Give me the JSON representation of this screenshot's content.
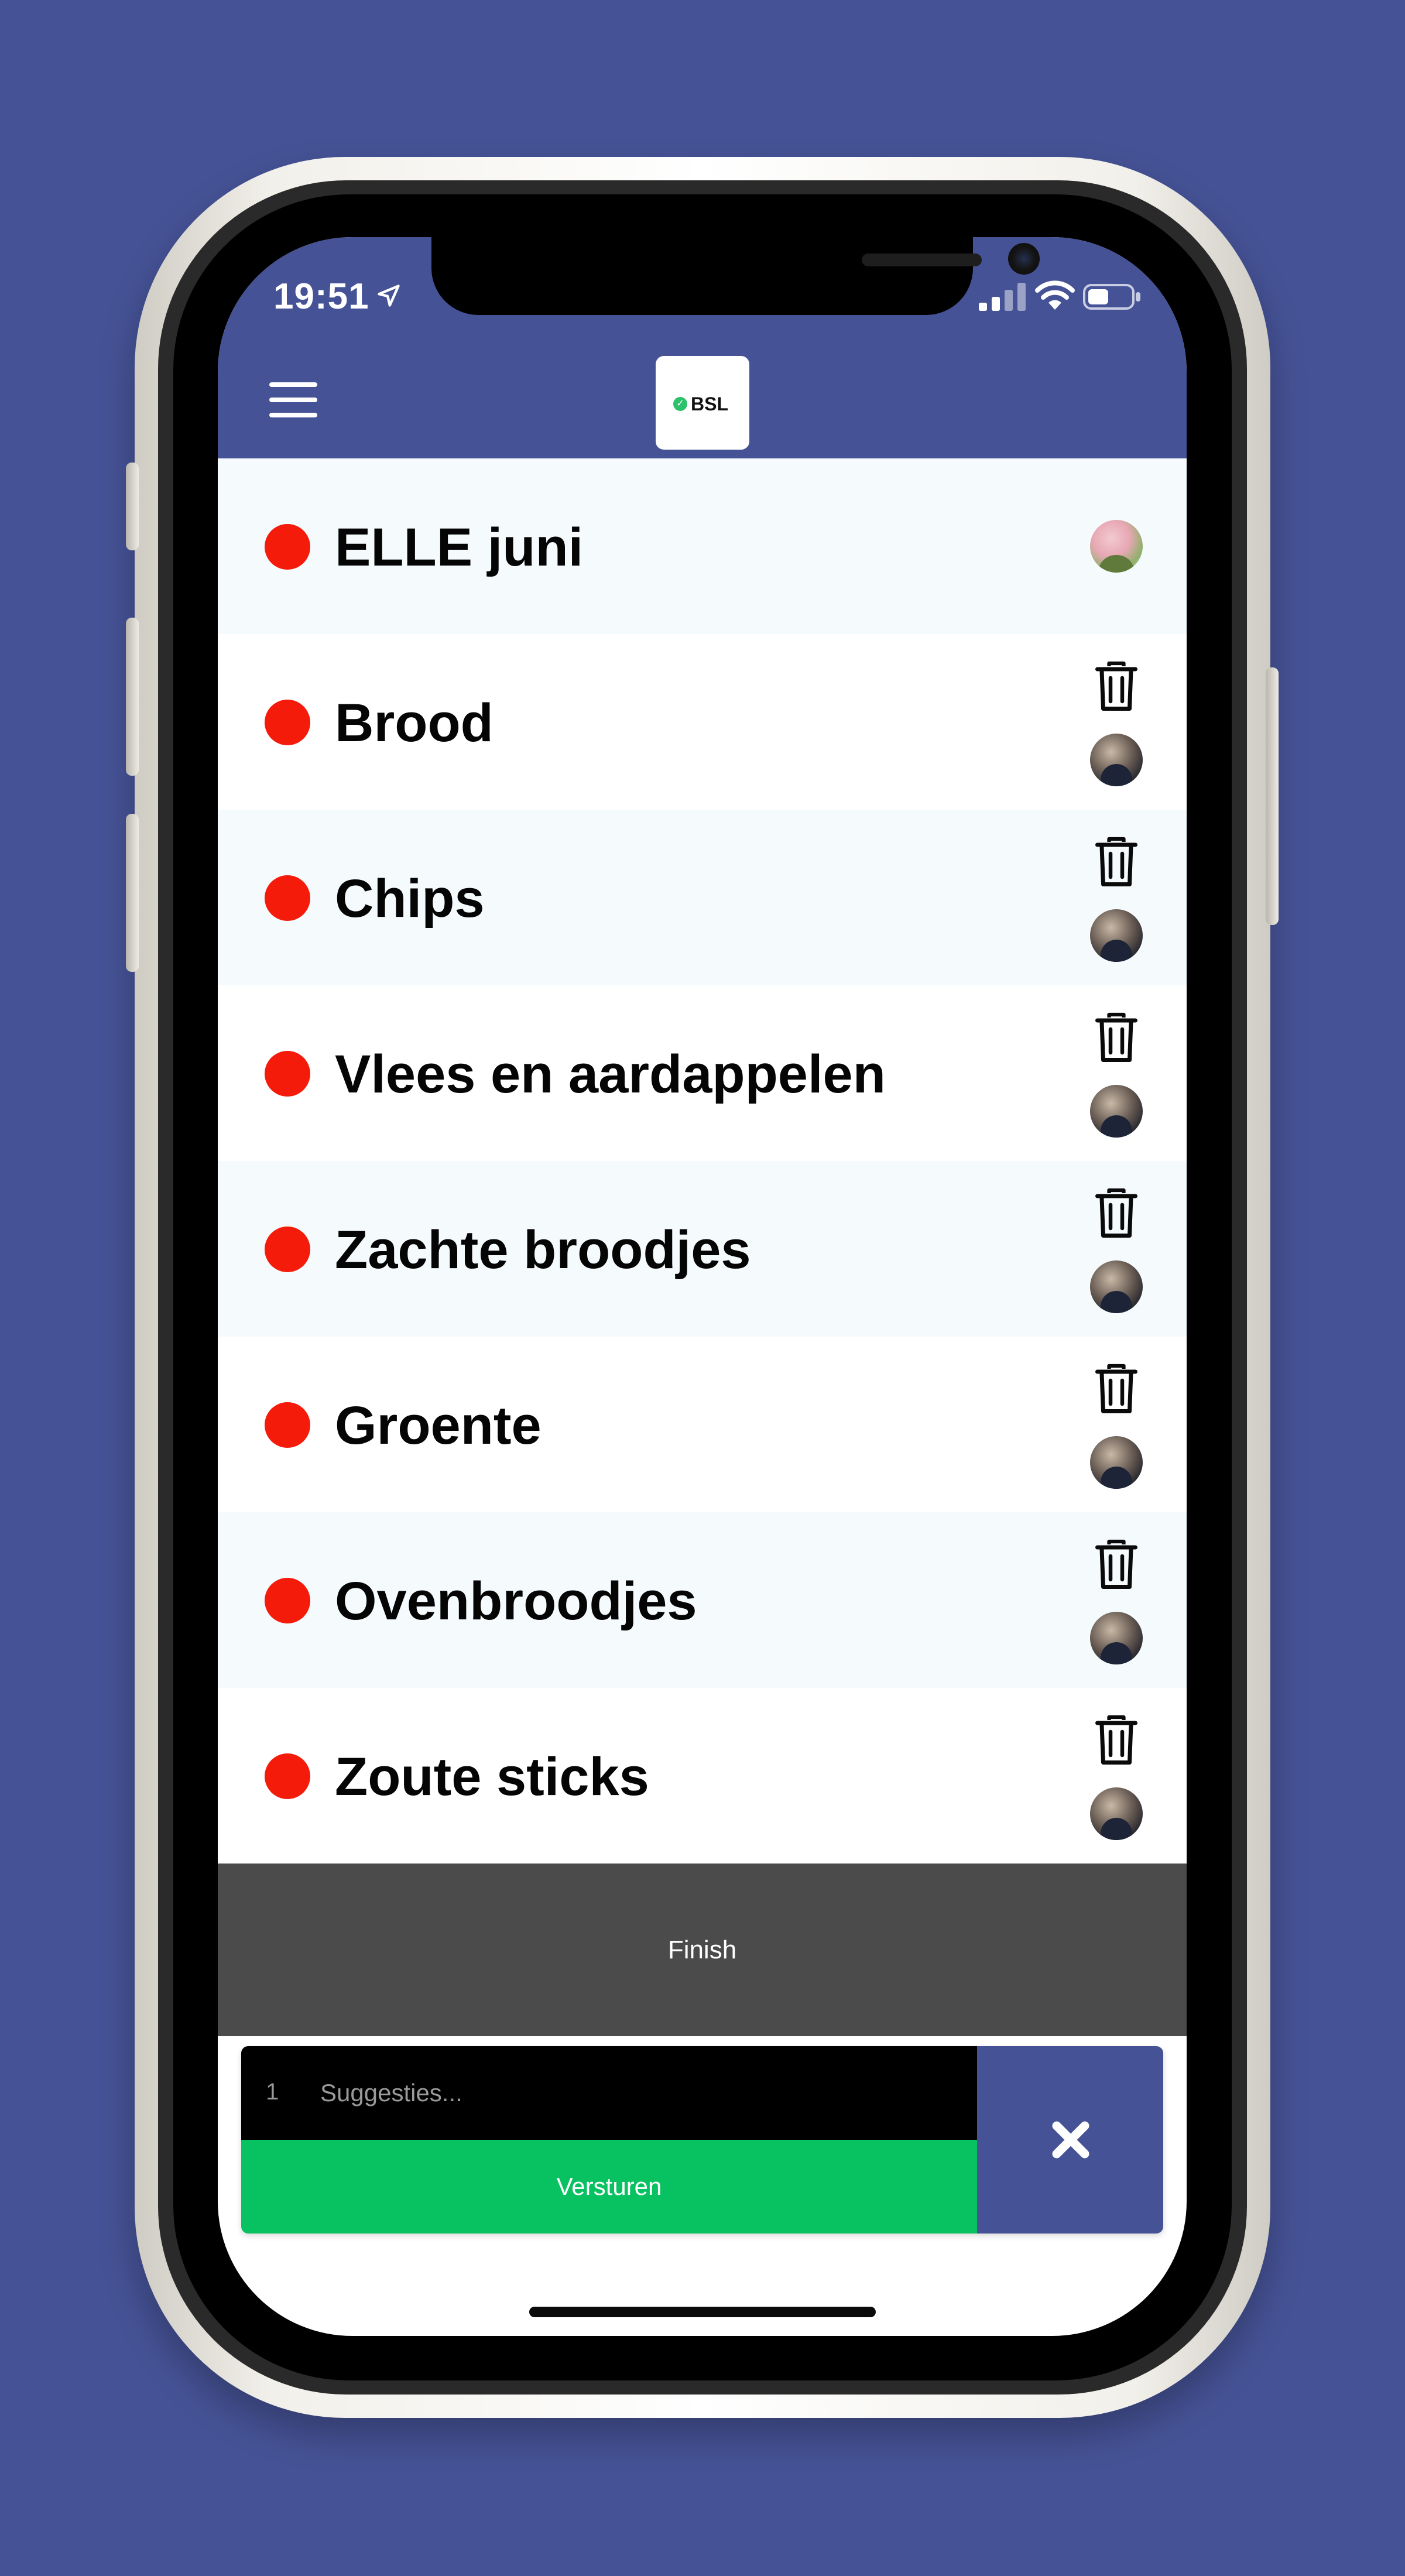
{
  "status_bar": {
    "time": "19:51",
    "icons": [
      "location-arrow-icon",
      "signal-icon",
      "wifi-icon",
      "battery-icon"
    ]
  },
  "header": {
    "menu_icon": "hamburger-icon",
    "logo_text": "BSL"
  },
  "colors": {
    "brand": "#455295",
    "status_dot": "#f51b0b",
    "finish_bar": "#4b4b4b",
    "send_button": "#08c160"
  },
  "items": [
    {
      "name": "ELLE juni",
      "deletable": false
    },
    {
      "name": "Brood",
      "deletable": true
    },
    {
      "name": "Chips",
      "deletable": true
    },
    {
      "name": "Vlees en aardappelen",
      "deletable": true
    },
    {
      "name": "Zachte broodjes",
      "deletable": true
    },
    {
      "name": "Groente",
      "deletable": true
    },
    {
      "name": "Ovenbroodjes",
      "deletable": true
    },
    {
      "name": "Zoute sticks",
      "deletable": true
    }
  ],
  "finish": {
    "label": "Finish"
  },
  "suggestion": {
    "count": "1",
    "placeholder": "Suggesties...",
    "send_label": "Versturen",
    "close_icon": "close-icon"
  }
}
